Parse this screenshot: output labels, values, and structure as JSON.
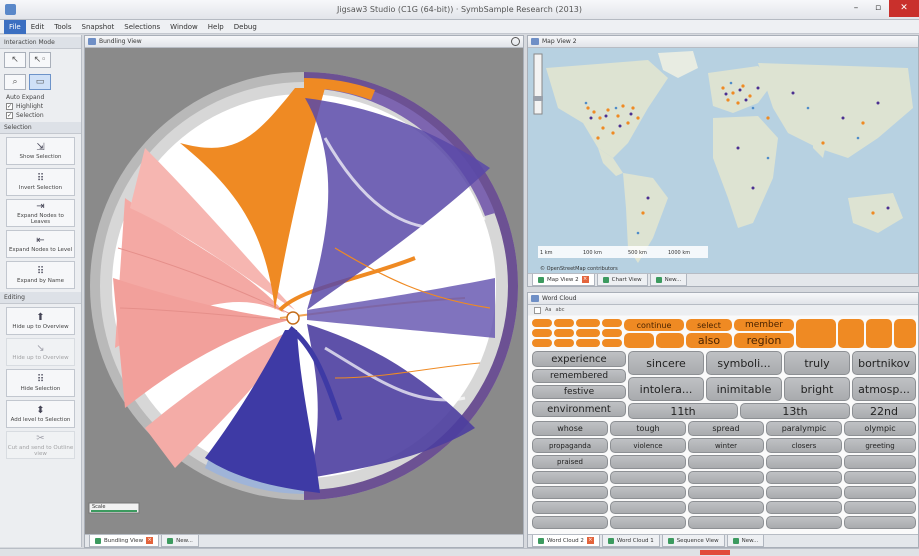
{
  "window": {
    "title": "Jigsaw3 Studio (C1G (64-bit)) · SymbSample Research (2013)",
    "buttons": [
      "–",
      "▫",
      "✕"
    ]
  },
  "menubar": {
    "items": [
      "File",
      "Edit",
      "Tools",
      "Snapshot",
      "Selections",
      "Window",
      "Help",
      "Debug"
    ]
  },
  "left_panel": {
    "interaction_mode_label": "Interaction Mode",
    "auto_expand_label": "Auto Expand",
    "highlight_label": "Highlight",
    "selection_check_label": "Selection",
    "selection_header": "Selection",
    "selection_tools": [
      {
        "icon": "⇲",
        "label": "Show Selection"
      },
      {
        "icon": "⠿",
        "label": "Invert Selection"
      },
      {
        "icon": "⇥",
        "label": "Expand Nodes to Leaves"
      },
      {
        "icon": "⇤",
        "label": "Expand Nodes to Level"
      },
      {
        "icon": "⠿",
        "label": "Expand by Name"
      }
    ],
    "editing_header": "Editing",
    "editing_tools": [
      {
        "icon": "⬆",
        "label": "Hide up to Overview",
        "dim": false
      },
      {
        "icon": "↘",
        "label": "Hide up to Overview",
        "dim": true
      },
      {
        "icon": "⠿",
        "label": "Hide Selection",
        "dim": false
      },
      {
        "icon": "⬍",
        "label": "Add level to Selection",
        "dim": false
      },
      {
        "icon": "✂",
        "label": "Cut and send to Outline view",
        "dim": true
      }
    ]
  },
  "bundling_view": {
    "title": "Bundling View",
    "legend_label": "Scale",
    "tabs": [
      {
        "label": "Bundling View",
        "active": true
      },
      {
        "label": "New...",
        "active": false
      }
    ]
  },
  "map_view": {
    "title": "Map View 2",
    "scale_labels": [
      "1 km",
      "100 km",
      "500 km",
      "1000 km"
    ],
    "attribution": "© OpenStreetMap contributors",
    "tabs": [
      {
        "label": "Map View 2",
        "active": true
      },
      {
        "label": "Chart View",
        "active": false
      },
      {
        "label": "New...",
        "active": false
      }
    ]
  },
  "word_cloud": {
    "title": "Word Cloud",
    "toolbar_labels": [
      "Aa",
      "abc"
    ],
    "orange_tags": [
      {
        "text": "continue"
      },
      {
        "text": "select"
      },
      {
        "text": "member"
      },
      {
        "text": "also"
      },
      {
        "text": "region"
      }
    ],
    "gray_tags": [
      {
        "text": "experience"
      },
      {
        "text": "sincere"
      },
      {
        "text": "symboli..."
      },
      {
        "text": "truly"
      },
      {
        "text": "bortnikov"
      },
      {
        "text": "remembered"
      },
      {
        "text": "festive"
      },
      {
        "text": "intolera..."
      },
      {
        "text": "inimitable"
      },
      {
        "text": "bright"
      },
      {
        "text": "atmosp..."
      },
      {
        "text": "environment"
      },
      {
        "text": "11th"
      },
      {
        "text": "13th"
      },
      {
        "text": "22nd"
      },
      {
        "text": "whose"
      },
      {
        "text": "tough"
      },
      {
        "text": "spread"
      },
      {
        "text": "paralympic"
      },
      {
        "text": "olympic"
      },
      {
        "text": "propaganda"
      },
      {
        "text": "violence"
      },
      {
        "text": "winter"
      },
      {
        "text": "closers"
      },
      {
        "text": "greeting"
      },
      {
        "text": "praised"
      }
    ],
    "tabs": [
      {
        "label": "Word Cloud 2",
        "active": true
      },
      {
        "label": "Word Cloud 1",
        "active": false
      },
      {
        "label": "Sequence View",
        "active": false
      },
      {
        "label": "New...",
        "active": false
      }
    ]
  },
  "colors": {
    "accent_orange": "#ef8a23",
    "accent_purple": "#4b2f91",
    "accent_pink": "#f2a6a2",
    "accent_blue": "#3b6fc1"
  }
}
